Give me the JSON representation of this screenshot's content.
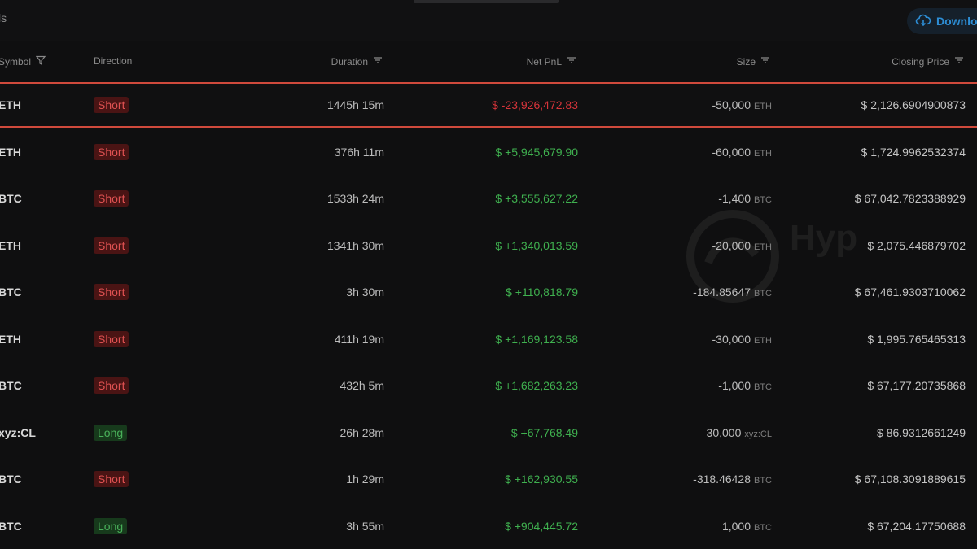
{
  "topbar": {
    "title": "ls",
    "download_label": "Downlo"
  },
  "watermark": {
    "text": "Hyp"
  },
  "table": {
    "columns": {
      "symbol": "Symbol",
      "direction": "Direction",
      "duration": "Duration",
      "net_pnl": "Net PnL",
      "size": "Size",
      "closing_price": "Closing Price"
    },
    "rows": [
      {
        "symbol": "ETH",
        "direction": "Short",
        "duration": "1445h 15m",
        "pnl": "$ -23,926,472.83",
        "size": "-50,000",
        "unit": "ETH",
        "closing": "$ 2,126.6904900873"
      },
      {
        "symbol": "ETH",
        "direction": "Short",
        "duration": "376h 11m",
        "pnl": "$ +5,945,679.90",
        "size": "-60,000",
        "unit": "ETH",
        "closing": "$ 1,724.9962532374"
      },
      {
        "symbol": "BTC",
        "direction": "Short",
        "duration": "1533h 24m",
        "pnl": "$ +3,555,627.22",
        "size": "-1,400",
        "unit": "BTC",
        "closing": "$ 67,042.7823388929"
      },
      {
        "symbol": "ETH",
        "direction": "Short",
        "duration": "1341h 30m",
        "pnl": "$ +1,340,013.59",
        "size": "-20,000",
        "unit": "ETH",
        "closing": "$ 2,075.446879702"
      },
      {
        "symbol": "BTC",
        "direction": "Short",
        "duration": "3h 30m",
        "pnl": "$ +110,818.79",
        "size": "-184.85647",
        "unit": "BTC",
        "closing": "$ 67,461.9303710062"
      },
      {
        "symbol": "ETH",
        "direction": "Short",
        "duration": "411h 19m",
        "pnl": "$ +1,169,123.58",
        "size": "-30,000",
        "unit": "ETH",
        "closing": "$ 1,995.765465313"
      },
      {
        "symbol": "BTC",
        "direction": "Short",
        "duration": "432h 5m",
        "pnl": "$ +1,682,263.23",
        "size": "-1,000",
        "unit": "BTC",
        "closing": "$ 67,177.20735868"
      },
      {
        "symbol": "xyz:CL",
        "direction": "Long",
        "duration": "26h 28m",
        "pnl": "$ +67,768.49",
        "size": "30,000",
        "unit": "xyz:CL",
        "closing": "$ 86.9312661249"
      },
      {
        "symbol": "BTC",
        "direction": "Short",
        "duration": "1h 29m",
        "pnl": "$ +162,930.55",
        "size": "-318.46428",
        "unit": "BTC",
        "closing": "$ 67,108.3091889615"
      },
      {
        "symbol": "BTC",
        "direction": "Long",
        "duration": "3h 55m",
        "pnl": "$ +904,445.72",
        "size": "1,000",
        "unit": "BTC",
        "closing": "$ 67,204.17750688"
      }
    ]
  },
  "colors": {
    "background": "#0f0f10",
    "short_badge": "#e05252",
    "long_badge": "#49b05a",
    "pnl_positive": "#3fb04f",
    "pnl_negative": "#d6343a",
    "highlight_border": "#d04a3c",
    "download_accent": "#2d8ed6"
  },
  "icons": {
    "download": "download-cloud-icon",
    "filter": "filter-icon",
    "sort": "sort-icon"
  }
}
